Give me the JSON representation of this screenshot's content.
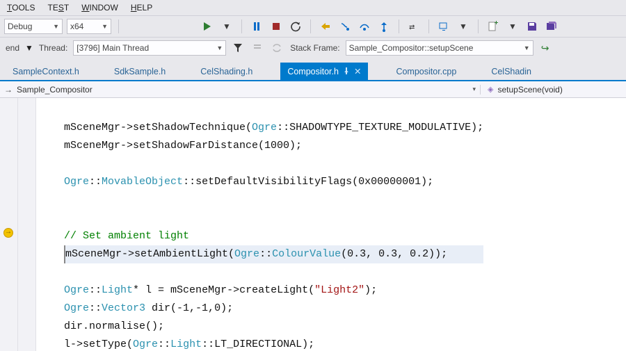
{
  "menubar": {
    "tools": "TOOLS",
    "test": "TEST",
    "window": "WINDOW",
    "help": "HELP"
  },
  "toolbar1": {
    "config": "Debug",
    "platform": "x64"
  },
  "toolbar2": {
    "end_label": "end",
    "thread_label": "Thread:",
    "thread_value": "[3796] Main Thread",
    "stackframe_label": "Stack Frame:",
    "stackframe_value": "Sample_Compositor::setupScene"
  },
  "tabs": [
    {
      "label": "SampleContext.h",
      "active": false
    },
    {
      "label": "SdkSample.h",
      "active": false
    },
    {
      "label": "CelShading.h",
      "active": false
    },
    {
      "label": "Compositor.h",
      "active": true
    },
    {
      "label": "Compositor.cpp",
      "active": false
    },
    {
      "label": "CelShadin",
      "active": false
    }
  ],
  "breadcrumb": {
    "scope": "Sample_Compositor",
    "member": "setupScene(void)"
  },
  "code": {
    "l1a": "mSceneMgr->setShadowTechnique(",
    "l1t": "Ogre",
    "l1b": "::SHADOWTYPE_TEXTURE_MODULATIVE);",
    "l2a": "mSceneMgr->setShadowFarDistance(1000);",
    "l3": "",
    "l4t1": "Ogre",
    "l4a": "::",
    "l4t2": "MovableObject",
    "l4b": "::setDefaultVisibilityFlags(0x00000001);",
    "l5": "",
    "l6": "",
    "l7c": "// Set ambient light",
    "l8a": "mSceneMgr->setAmbientLight(",
    "l8t1": "Ogre",
    "l8b": "::",
    "l8t2": "ColourValue",
    "l8c": "(0.3, 0.3, 0.2));",
    "l9": "",
    "l10t1": "Ogre",
    "l10a": "::",
    "l10t2": "Light",
    "l10b": "* l = mSceneMgr->createLight(",
    "l10s": "\"Light2\"",
    "l10c": ");",
    "l11t1": "Ogre",
    "l11a": "::",
    "l11t2": "Vector3",
    "l11b": " dir(-1,-1,0);",
    "l12": "dir.normalise();",
    "l13a": "l->setType(",
    "l13t1": "Ogre",
    "l13b": "::",
    "l13t2": "Light",
    "l13c": "::LT_DIRECTIONAL);"
  },
  "breakpoint_line_index": 7
}
